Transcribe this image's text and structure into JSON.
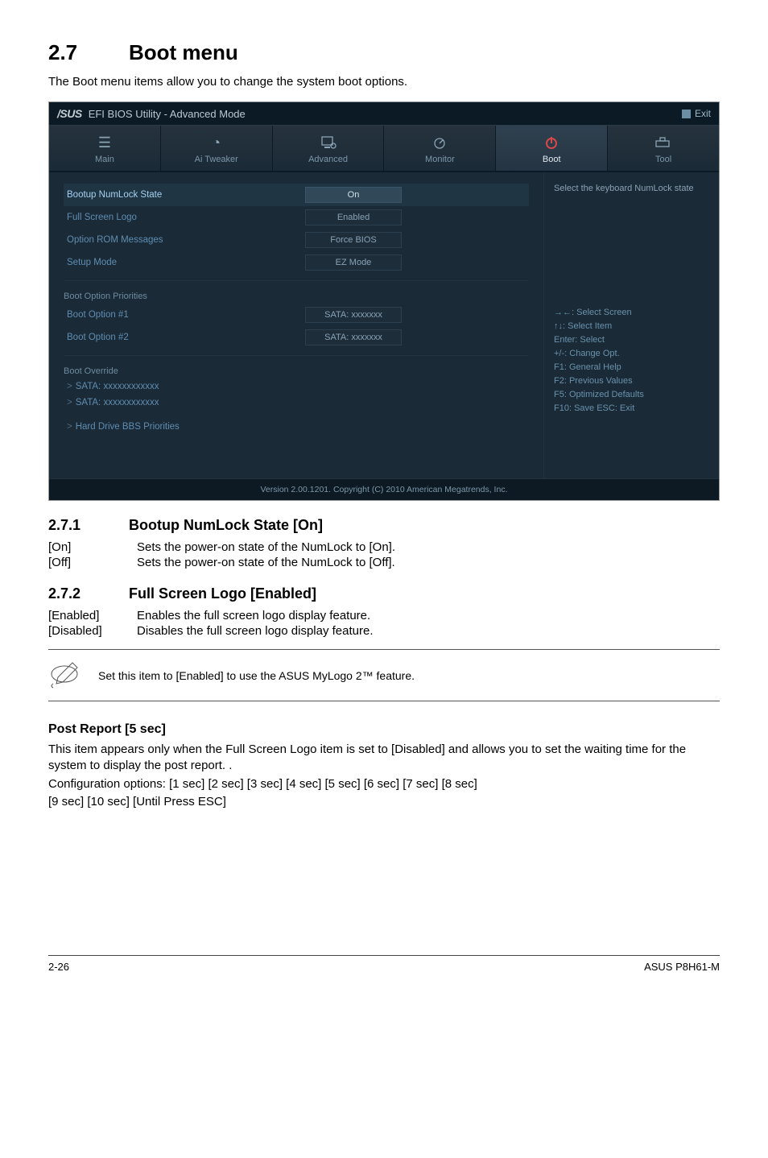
{
  "heading": {
    "num": "2.7",
    "title": "Boot menu"
  },
  "intro": "The Boot menu items allow you to change the system boot options.",
  "bios": {
    "logo": "/SUS",
    "title": "EFI BIOS Utility - Advanced Mode",
    "exit": "Exit",
    "tabs": {
      "main": "Main",
      "aitweaker": "Ai  Tweaker",
      "advanced": "Advanced",
      "monitor": "Monitor",
      "boot": "Boot",
      "tool": "Tool"
    },
    "settings": {
      "numlock_label": "Bootup NumLock State",
      "numlock_value": "On",
      "fullscreen_label": "Full Screen Logo",
      "fullscreen_value": "Enabled",
      "optionrom_label": "Option ROM Messages",
      "optionrom_value": "Force BIOS",
      "setupmode_label": "Setup Mode",
      "setupmode_value": "EZ Mode",
      "priorities_header": "Boot Option Priorities",
      "bootopt1_label": "Boot Option #1",
      "bootopt1_value": "SATA: xxxxxxx",
      "bootopt2_label": "Boot Option #2",
      "bootopt2_value": "SATA: xxxxxxx",
      "override_header": "Boot Override",
      "sata1": "SATA: xxxxxxxxxxxx",
      "sata2": "SATA: xxxxxxxxxxxx",
      "harddrivebbs": "Hard Drive BBS Priorities"
    },
    "right": {
      "help": "Select the keyboard NumLock state",
      "keys": [
        "→←:  Select Screen",
        "↑↓:  Select Item",
        "Enter:  Select",
        "+/-:  Change Opt.",
        "F1:  General Help",
        "F2:  Previous Values",
        "F5:  Optimized Defaults",
        "F10:  Save   ESC:  Exit"
      ]
    },
    "footer": "Version  2.00.1201.   Copyright  (C)  2010 American  Megatrends,  Inc."
  },
  "s271": {
    "num": "2.7.1",
    "title": "Bootup NumLock State [On]",
    "opts": [
      {
        "k": "[On]",
        "v": "Sets the power-on state of the NumLock to [On]."
      },
      {
        "k": "[Off]",
        "v": "Sets the power-on state of the NumLock to [Off]."
      }
    ]
  },
  "s272": {
    "num": "2.7.2",
    "title": "Full Screen Logo [Enabled]",
    "opts": [
      {
        "k": "[Enabled]",
        "v": "Enables the full screen logo display feature."
      },
      {
        "k": "[Disabled]",
        "v": "Disables the full screen logo display feature."
      }
    ]
  },
  "note": "Set this item to [Enabled] to use the ASUS MyLogo 2™ feature.",
  "post": {
    "title": "Post Report [5 sec]",
    "p1": "This item appears only when the Full Screen Logo item is set to [Disabled] and allows you to set the waiting time for the system to display the post report. .",
    "p2": "Configuration options: [1 sec] [2 sec] [3 sec] [4 sec] [5 sec] [6 sec] [7 sec] [8 sec]",
    "p3": "[9 sec] [10 sec] [Until Press ESC]"
  },
  "pagefooter": {
    "left": "2-26",
    "right": "ASUS P8H61-M"
  }
}
